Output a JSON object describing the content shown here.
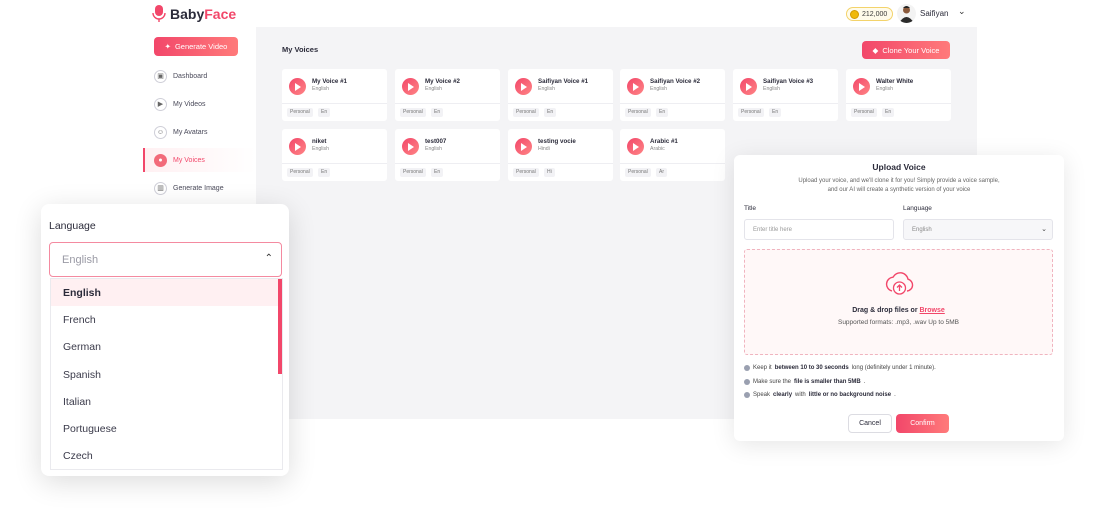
{
  "brand": {
    "part1": "Baby",
    "part2": "Face"
  },
  "header": {
    "coins": "212,000",
    "username": "Saifiyan"
  },
  "sidebar": {
    "generate_label": "Generate Video",
    "items": [
      {
        "label": "Dashboard",
        "icon": "dashboard-icon"
      },
      {
        "label": "My Videos",
        "icon": "video-icon"
      },
      {
        "label": "My Avatars",
        "icon": "avatar-icon"
      },
      {
        "label": "My Voices",
        "icon": "microphone-icon",
        "active": true
      },
      {
        "label": "Generate Image",
        "icon": "image-icon"
      }
    ]
  },
  "main": {
    "title": "My Voices",
    "clone_label": "Clone Your Voice",
    "voices": [
      {
        "title": "My Voice #1",
        "lang": "English",
        "tag1": "Personal",
        "tag2": "En"
      },
      {
        "title": "My Voice #2",
        "lang": "English",
        "tag1": "Personal",
        "tag2": "En"
      },
      {
        "title": "Saifiyan Voice #1",
        "lang": "English",
        "tag1": "Personal",
        "tag2": "En"
      },
      {
        "title": "Saifiyan Voice #2",
        "lang": "English",
        "tag1": "Personal",
        "tag2": "En"
      },
      {
        "title": "Saifiyan Voice #3",
        "lang": "English",
        "tag1": "Personal",
        "tag2": "En"
      },
      {
        "title": "Walter White",
        "lang": "English",
        "tag1": "Personal",
        "tag2": "En"
      },
      {
        "title": "niket",
        "lang": "English",
        "tag1": "Personal",
        "tag2": "En"
      },
      {
        "title": "test007",
        "lang": "English",
        "tag1": "Personal",
        "tag2": "En"
      },
      {
        "title": "testing vocie",
        "lang": "Hindi",
        "tag1": "Personal",
        "tag2": "Hi"
      },
      {
        "title": "Arabic #1",
        "lang": "Arabic",
        "tag1": "Personal",
        "tag2": "Ar"
      }
    ]
  },
  "language_dropdown": {
    "label": "Language",
    "selected": "English",
    "options": [
      "English",
      "French",
      "German",
      "Spanish",
      "Italian",
      "Portuguese",
      "Czech"
    ]
  },
  "upload_modal": {
    "title": "Upload Voice",
    "desc_line1": "Upload your voice, and we'll clone it for you! Simply provide a voice sample,",
    "desc_line2": "and our AI will create a synthetic version of your voice",
    "title_label": "Title",
    "title_placeholder": "Enter title here",
    "language_label": "Language",
    "language_value": "English",
    "drop_text": "Drag & drop files or",
    "browse_text": "Browse",
    "formats": "Supported formats: .mp3, .wav Up to 5MB",
    "tip1_a": "Keep it",
    "tip1_b": "between 10 to 30 seconds",
    "tip1_c": "long (definitely under 1 minute).",
    "tip2_a": "Make sure the",
    "tip2_b": "file is smaller than 5MB",
    "tip2_c": ".",
    "tip3_a": "Speak",
    "tip3_b": "clearly",
    "tip3_c": "with",
    "tip3_d": "little or no background noise",
    "tip3_e": ".",
    "cancel_label": "Cancel",
    "confirm_label": "Confirm"
  },
  "colors": {
    "accent": "#f2476a",
    "panel_bg": "#f4f4f6"
  }
}
